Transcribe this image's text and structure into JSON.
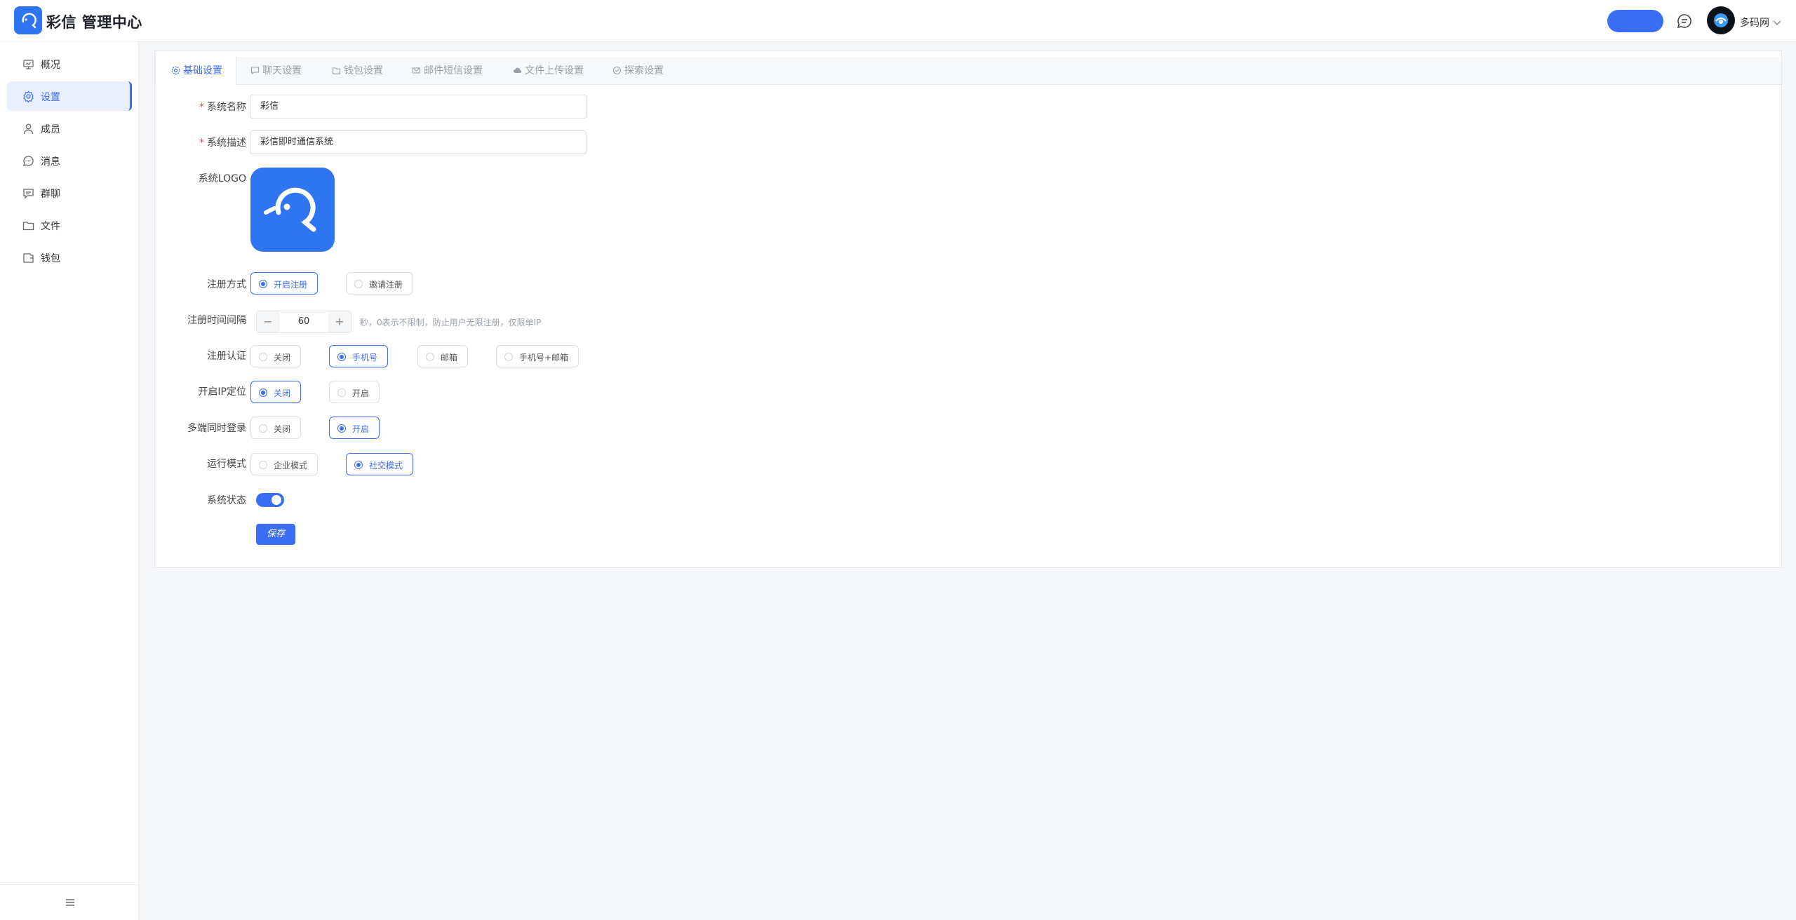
{
  "header": {
    "brand": "彩信 管理中心",
    "username": "多码网",
    "accent": "#3b6ef5"
  },
  "sidebar": {
    "items": [
      {
        "label": "概况",
        "icon": "dashboard-icon"
      },
      {
        "label": "设置",
        "icon": "gear-icon",
        "active": true
      },
      {
        "label": "成员",
        "icon": "user-icon"
      },
      {
        "label": "消息",
        "icon": "chat-icon"
      },
      {
        "label": "群聊",
        "icon": "group-chat-icon"
      },
      {
        "label": "文件",
        "icon": "folder-icon"
      },
      {
        "label": "钱包",
        "icon": "wallet-icon"
      }
    ]
  },
  "tabs": [
    {
      "label": "基础设置",
      "icon": "gear-icon",
      "active": true
    },
    {
      "label": "聊天设置",
      "icon": "chat-icon"
    },
    {
      "label": "钱包设置",
      "icon": "wallet-icon"
    },
    {
      "label": "邮件短信设置",
      "icon": "mail-icon"
    },
    {
      "label": "文件上传设置",
      "icon": "cloud-upload-icon"
    },
    {
      "label": "探索设置",
      "icon": "compass-icon"
    }
  ],
  "form": {
    "system_name": {
      "label": "系统名称",
      "value": "彩信"
    },
    "system_desc": {
      "label": "系统描述",
      "value": "彩信即时通信系统"
    },
    "system_logo": {
      "label": "系统LOGO"
    },
    "register_mode": {
      "label": "注册方式",
      "options": [
        "开启注册",
        "邀请注册"
      ],
      "selected": 0
    },
    "register_interval": {
      "label": "注册时间间隔",
      "value": "60",
      "minus": "−",
      "plus": "+",
      "hint": "秒，0表示不限制，防止用户无限注册，仅限单IP"
    },
    "register_verify": {
      "label": "注册认证",
      "options": [
        "关闭",
        "手机号",
        "邮箱",
        "手机号+邮箱"
      ],
      "selected": 1
    },
    "ip_location": {
      "label": "开启IP定位",
      "options": [
        "关闭",
        "开启"
      ],
      "selected": 0
    },
    "multi_login": {
      "label": "多端同时登录",
      "options": [
        "关闭",
        "开启"
      ],
      "selected": 1
    },
    "run_mode": {
      "label": "运行模式",
      "options": [
        "企业模式",
        "社交模式"
      ],
      "selected": 1
    },
    "system_status": {
      "label": "系统状态",
      "on": true
    },
    "save_label": "保存"
  }
}
